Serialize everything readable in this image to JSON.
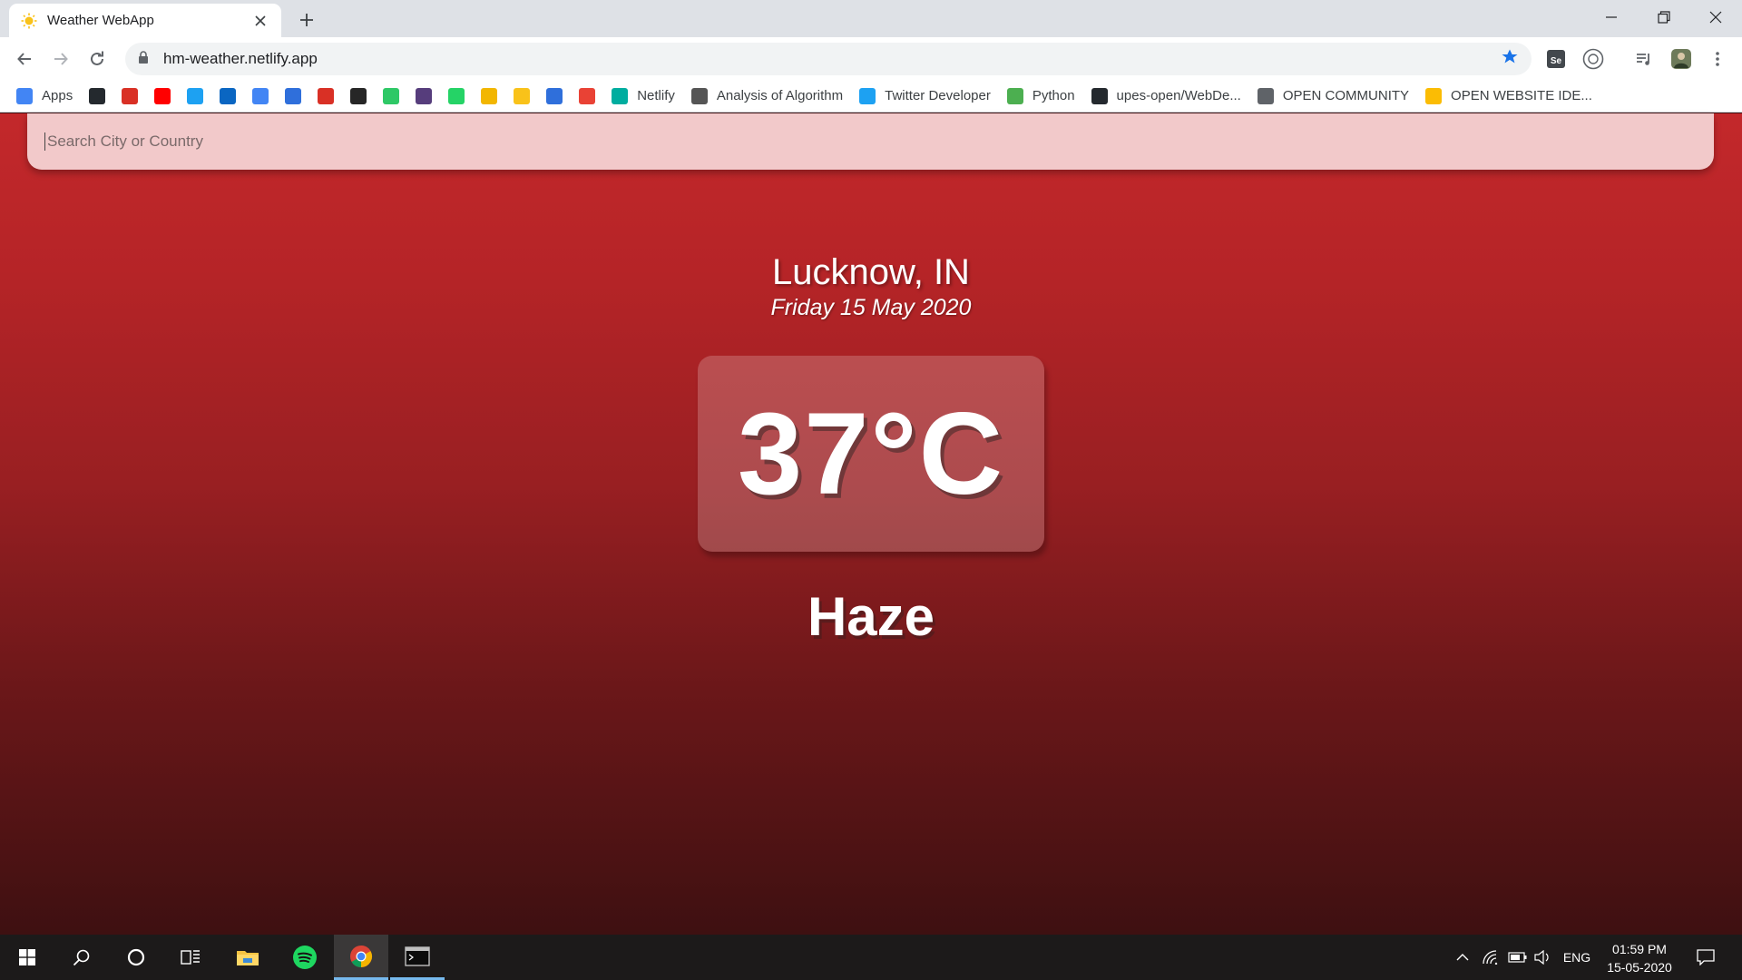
{
  "browser": {
    "tab": {
      "title": "Weather WebApp",
      "favicon": "sun-icon"
    },
    "url": "hm-weather.netlify.app",
    "bookmarks": [
      {
        "label": "Apps",
        "icon": "apps-grid-icon",
        "color": "#4285f4"
      },
      {
        "label": "",
        "icon": "github-icon",
        "color": "#24292e"
      },
      {
        "label": "",
        "icon": "gmail-icon",
        "color": "#d93025"
      },
      {
        "label": "",
        "icon": "youtube-icon",
        "color": "#ff0000"
      },
      {
        "label": "",
        "icon": "twitter-icon",
        "color": "#1da1f2"
      },
      {
        "label": "",
        "icon": "linkedin-icon",
        "color": "#0a66c2"
      },
      {
        "label": "",
        "icon": "google-classroom-icon",
        "color": "#4285f4"
      },
      {
        "label": "",
        "icon": "codechef-icon",
        "color": "#2f6fdb"
      },
      {
        "label": "",
        "icon": "gmail-icon",
        "color": "#d93025"
      },
      {
        "label": "",
        "icon": "blackboard-icon",
        "color": "#262626"
      },
      {
        "label": "",
        "icon": "hackerrank-icon",
        "color": "#2ec866"
      },
      {
        "label": "",
        "icon": "bootstrap-icon",
        "color": "#563d7c"
      },
      {
        "label": "",
        "icon": "whatsapp-icon",
        "color": "#25d366"
      },
      {
        "label": "",
        "icon": "hackerearth-icon",
        "color": "#f2b600"
      },
      {
        "label": "",
        "icon": "sun-icon",
        "color": "#f9c21a"
      },
      {
        "label": "",
        "icon": "infinity-icon",
        "color": "#2f6fdb"
      },
      {
        "label": "",
        "icon": "colorful-grid-icon",
        "color": "#e94235"
      },
      {
        "label": "Netlify",
        "icon": "netlify-icon",
        "color": "#00ad9f"
      },
      {
        "label": "Analysis of Algorithm",
        "icon": "doc-icon",
        "color": "#555555"
      },
      {
        "label": "Twitter Developer",
        "icon": "twitter-icon",
        "color": "#1da1f2"
      },
      {
        "label": "Python",
        "icon": "w3schools-icon",
        "color": "#4caf50"
      },
      {
        "label": "upes-open/WebDe...",
        "icon": "github-icon",
        "color": "#24292e"
      },
      {
        "label": "OPEN COMMUNITY",
        "icon": "globe-icon",
        "color": "#5f6368"
      },
      {
        "label": "OPEN WEBSITE IDE...",
        "icon": "google-drive-icon",
        "color": "#fbbc04"
      }
    ]
  },
  "app": {
    "search_placeholder": "Search City or Country",
    "location": "Lucknow, IN",
    "date": "Friday 15 May 2020",
    "temperature": "37°C",
    "condition": "Haze"
  },
  "taskbar": {
    "apps": [
      "windows-start-icon",
      "search-icon",
      "cortana-icon",
      "task-view-icon",
      "file-explorer-icon",
      "spotify-icon",
      "chrome-icon",
      "terminal-icon"
    ],
    "language": "ENG",
    "time": "01:59 PM",
    "date": "15-05-2020"
  }
}
